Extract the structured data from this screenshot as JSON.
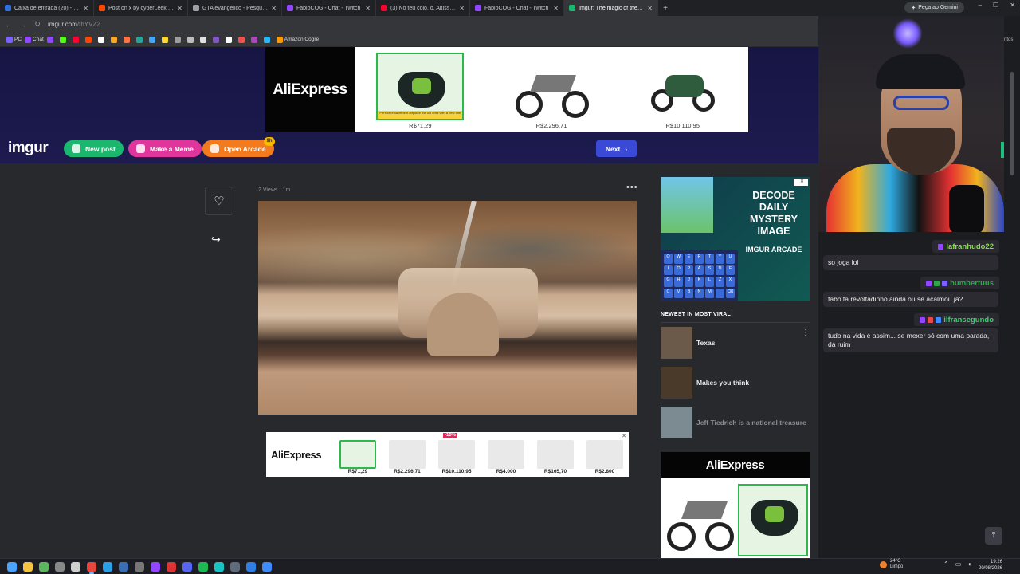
{
  "browser": {
    "tabs": [
      {
        "title": "Caixa de entrada (20) - E-mail",
        "color": "#2f6fde",
        "active": false
      },
      {
        "title": "Post on x by cyberLeek r/GTA",
        "color": "#ff4500",
        "active": false
      },
      {
        "title": "GTA evangelico - Pesquisa G",
        "color": "#9aa0a6",
        "active": false
      },
      {
        "title": "FabioCOG - Chat - Twitch",
        "color": "#9146ff",
        "active": false
      },
      {
        "title": "(3) No teu colo, ó, Altíssimo vo",
        "color": "#ff0033",
        "active": false
      },
      {
        "title": "FabioCOG - Chat - Twitch",
        "color": "#9146ff",
        "active": false
      },
      {
        "title": "Imgur: The magic of the Interne",
        "color": "#1bb76e",
        "active": true
      }
    ],
    "new_tab": "+",
    "gemini_label": "Peça ao Gemini",
    "window_controls": [
      "–",
      "❐",
      "✕"
    ],
    "url_host": "imgur.com",
    "url_path": "/thYVZ2",
    "bookmarks": [
      {
        "label": "PC",
        "color": "#7b61ff"
      },
      {
        "label": "Chat",
        "color": "#9146ff"
      },
      {
        "label": "",
        "color": "#9146ff"
      },
      {
        "label": "",
        "color": "#53fc18"
      },
      {
        "label": "",
        "color": "#ff0033"
      },
      {
        "label": "",
        "color": "#ff4500"
      },
      {
        "label": "",
        "color": "#ffffff"
      },
      {
        "label": "",
        "color": "#f9a825"
      },
      {
        "label": "",
        "color": "#ff7043"
      },
      {
        "label": "",
        "color": "#26a69a"
      },
      {
        "label": "",
        "color": "#42a5f5"
      },
      {
        "label": "",
        "color": "#fdd835"
      },
      {
        "label": "",
        "color": "#9e9e9e"
      },
      {
        "label": "",
        "color": "#bdbdbd"
      },
      {
        "label": "",
        "color": "#e0e0e0"
      },
      {
        "label": "",
        "color": "#7e57c2"
      },
      {
        "label": "",
        "color": "#ffffff"
      },
      {
        "label": "",
        "color": "#ef5350"
      },
      {
        "label": "",
        "color": "#ab47bc"
      },
      {
        "label": "",
        "color": "#29b6f6"
      },
      {
        "label": "Amazon Cogre",
        "color": "#ff9900"
      }
    ]
  },
  "imgur": {
    "top_ad": {
      "brand": "AliExpress",
      "products": [
        {
          "price": "R$71,29",
          "banner": "Perfect replacement Replace the old shell with a new one"
        },
        {
          "price": "R$2.296,71"
        },
        {
          "price": "R$10.110,95"
        }
      ]
    },
    "logo": "imgur",
    "buttons": {
      "new_post": "New post",
      "make_meme": "Make a Meme",
      "open_arcade": "Open Arcade",
      "arcade_badge": "9h",
      "next": "Next"
    },
    "post": {
      "meta": "2 Views · 1m",
      "menu": "•••"
    },
    "bottom_ad": {
      "brand": "AliExpress",
      "items": [
        {
          "price": "R$71,29",
          "discount": ""
        },
        {
          "price": "R$2.296,71",
          "discount": ""
        },
        {
          "price": "R$10.110,95",
          "discount": "-10%"
        },
        {
          "price": "R$4.000",
          "discount": ""
        },
        {
          "price": "R$165,70",
          "discount": ""
        },
        {
          "price": "R$2.800",
          "discount": ""
        }
      ],
      "close": "✕"
    },
    "right_ad": {
      "title": "DECODE DAILY MYSTERY IMAGE",
      "subtitle": "IMGUR ARCADE",
      "adchoice": "i ✕",
      "keys": [
        "Q",
        "W",
        "E",
        "R",
        "T",
        "Y",
        "U",
        "I",
        "O",
        "P",
        "A",
        "S",
        "D",
        "F",
        "G",
        "H",
        "J",
        "K",
        "L",
        "Z",
        "X",
        "C",
        "V",
        "B",
        "N",
        "M",
        "",
        "⌫"
      ]
    },
    "viral": {
      "heading": "NEWEST IN MOST VIRAL",
      "items": [
        {
          "label": "Texas",
          "dim": false
        },
        {
          "label": "Makes you think",
          "dim": false
        },
        {
          "label": "Jeff Tiedrich is a national treasure",
          "dim": true
        }
      ]
    },
    "right_ad2": {
      "brand": "AliExpress"
    },
    "scroll_top": "⤒"
  },
  "chat": {
    "messages": [
      {
        "user": "lafranhudo22",
        "user_color": "#8be04e",
        "text": "so joga lol"
      },
      {
        "user": "humbertuus",
        "user_color": "#2ea84a",
        "text": "fabo ta revoltadinho ainda ou se acalmou ja?"
      },
      {
        "user": "ilfransegundo",
        "user_color": "#36d36b",
        "text": "tudo na vida é assim... se mexer só com uma parada, dá ruim"
      }
    ]
  },
  "side_strip_text": "ntos",
  "taskbar": {
    "weather_temp": "24°C",
    "weather_desc": "Limpo",
    "time": "19:26",
    "date": "20/08/2026"
  }
}
